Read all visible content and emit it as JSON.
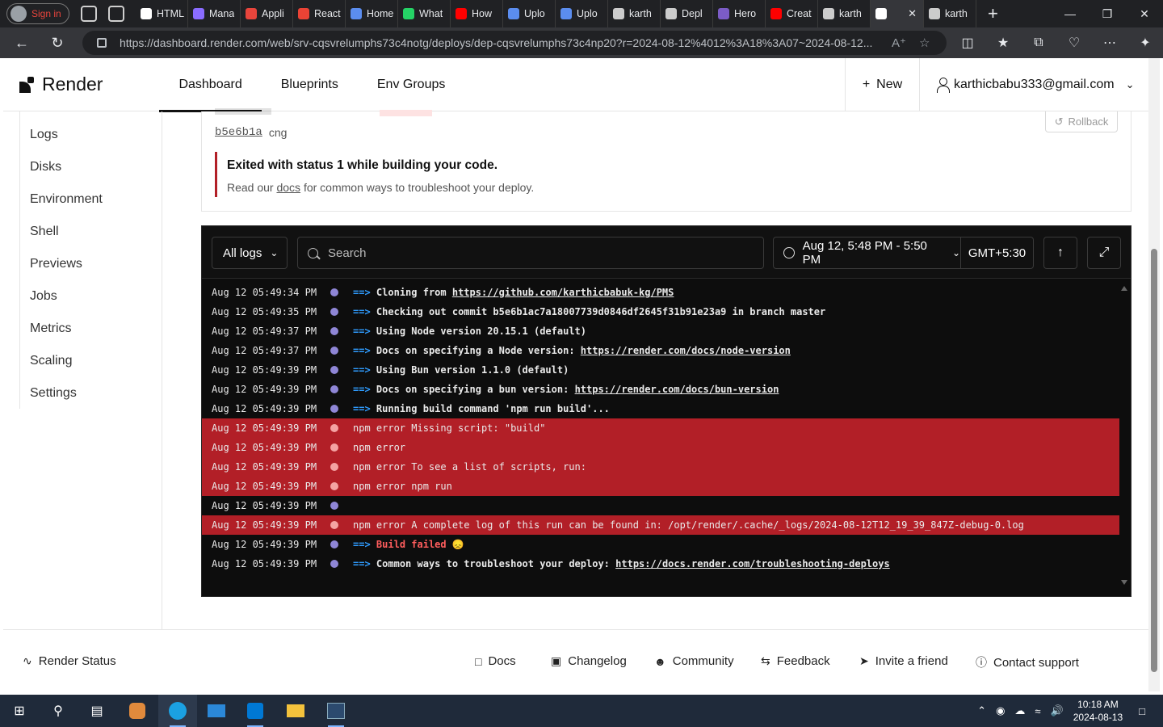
{
  "browser": {
    "profile_label": "Sign in",
    "tabs": [
      {
        "title": "HTML",
        "color": "#ffffff"
      },
      {
        "title": "Mana",
        "color": "#8a6cff"
      },
      {
        "title": "Appli",
        "color": "#e8453c"
      },
      {
        "title": "React",
        "color": "#ea4335"
      },
      {
        "title": "Home",
        "color": "#5b8def"
      },
      {
        "title": "What",
        "color": "#25d366"
      },
      {
        "title": "How",
        "color": "#ff0000"
      },
      {
        "title": "Uplo",
        "color": "#5b8def"
      },
      {
        "title": "Uplo",
        "color": "#5b8def"
      },
      {
        "title": "karth",
        "color": "#cccccc"
      },
      {
        "title": "Depl",
        "color": "#cccccc"
      },
      {
        "title": "Hero",
        "color": "#7b5cc6"
      },
      {
        "title": "Creat",
        "color": "#ff0000"
      },
      {
        "title": "karth",
        "color": "#cccccc"
      },
      {
        "title": "",
        "color": "#ffffff"
      },
      {
        "title": "karth",
        "color": "#cccccc"
      }
    ],
    "url": "https://dashboard.render.com/web/srv-cqsvrelumphs73c4notg/deploys/dep-cqsvrelumphs73c4np20?r=2024-08-12%4012%3A18%3A07~2024-08-12..."
  },
  "header": {
    "logo_text": "Render",
    "nav": [
      "Dashboard",
      "Blueprints",
      "Env Groups"
    ],
    "new_label": "New",
    "account_email": "karthicbabu333@gmail.com"
  },
  "sidebar": {
    "items": [
      "Logs",
      "Disks",
      "Environment",
      "Shell",
      "Previews",
      "Jobs",
      "Metrics",
      "Scaling",
      "Settings"
    ]
  },
  "deploy": {
    "commit_hash": "b5e6b1a",
    "commit_msg": "cng",
    "rollback_label": "Rollback",
    "error_title": "Exited with status 1 while building your code.",
    "error_desc_pre": "Read our ",
    "error_desc_link": "docs",
    "error_desc_post": " for common ways to troubleshoot your deploy."
  },
  "logs_toolbar": {
    "filter_label": "All logs",
    "search_placeholder": "Search",
    "time_range": "Aug 12, 5:48 PM - 5:50 PM",
    "timezone": "GMT+5:30"
  },
  "logs": [
    {
      "ts": "Aug 12 05:49:34 PM",
      "level": "info",
      "arrow": "==>",
      "text": "Cloning from ",
      "link": "https://github.com/karthicbabuk-kg/PMS",
      "strong": true
    },
    {
      "ts": "Aug 12 05:49:35 PM",
      "level": "info",
      "arrow": "==>",
      "text": "Checking out commit b5e6b1ac7a18007739d0846df2645f31b91e23a9 in branch master",
      "link": "",
      "strong": true
    },
    {
      "ts": "Aug 12 05:49:37 PM",
      "level": "info",
      "arrow": "==>",
      "text": "Using Node version 20.15.1 (default)",
      "link": "",
      "strong": true
    },
    {
      "ts": "Aug 12 05:49:37 PM",
      "level": "info",
      "arrow": "==>",
      "text": "Docs on specifying a Node version: ",
      "link": "https://render.com/docs/node-version",
      "strong": true
    },
    {
      "ts": "Aug 12 05:49:39 PM",
      "level": "info",
      "arrow": "==>",
      "text": "Using Bun version 1.1.0 (default)",
      "link": "",
      "strong": true
    },
    {
      "ts": "Aug 12 05:49:39 PM",
      "level": "info",
      "arrow": "==>",
      "text": "Docs on specifying a bun version: ",
      "link": "https://render.com/docs/bun-version",
      "strong": true
    },
    {
      "ts": "Aug 12 05:49:39 PM",
      "level": "info",
      "arrow": "==>",
      "text": "Running build command 'npm run build'...",
      "link": "",
      "strong": true
    },
    {
      "ts": "Aug 12 05:49:39 PM",
      "level": "error",
      "arrow": "",
      "text": "npm error Missing script: \"build\"",
      "link": "",
      "strong": false
    },
    {
      "ts": "Aug 12 05:49:39 PM",
      "level": "error",
      "arrow": "",
      "text": "npm error",
      "link": "",
      "strong": false
    },
    {
      "ts": "Aug 12 05:49:39 PM",
      "level": "error",
      "arrow": "",
      "text": "npm error To see a list of scripts, run:",
      "link": "",
      "strong": false
    },
    {
      "ts": "Aug 12 05:49:39 PM",
      "level": "error",
      "arrow": "",
      "text": "npm error   npm run",
      "link": "",
      "strong": false
    },
    {
      "ts": "Aug 12 05:49:39 PM",
      "level": "info",
      "arrow": "",
      "text": "",
      "link": "",
      "strong": false
    },
    {
      "ts": "Aug 12 05:49:39 PM",
      "level": "error",
      "arrow": "",
      "text": "npm error A complete log of this run can be found in: /opt/render/.cache/_logs/2024-08-12T12_19_39_847Z-debug-0.log",
      "link": "",
      "strong": false
    },
    {
      "ts": "Aug 12 05:49:39 PM",
      "level": "info",
      "arrow": "==>",
      "text": "Build failed 😞",
      "link": "",
      "strong": true,
      "fail": true
    },
    {
      "ts": "Aug 12 05:49:39 PM",
      "level": "info",
      "arrow": "==>",
      "text": "Common ways to troubleshoot your deploy: ",
      "link": "https://docs.render.com/troubleshooting-deploys",
      "strong": true
    }
  ],
  "footer": {
    "status": "Render Status",
    "links": [
      "Docs",
      "Changelog",
      "Community",
      "Feedback",
      "Invite a friend",
      "Contact support"
    ]
  },
  "taskbar": {
    "time": "10:18 AM",
    "date": "2024-08-13"
  },
  "colors": {
    "error_row": "#b21f27",
    "arrow": "#2f9cff",
    "info_dot": "#8f86d6"
  }
}
